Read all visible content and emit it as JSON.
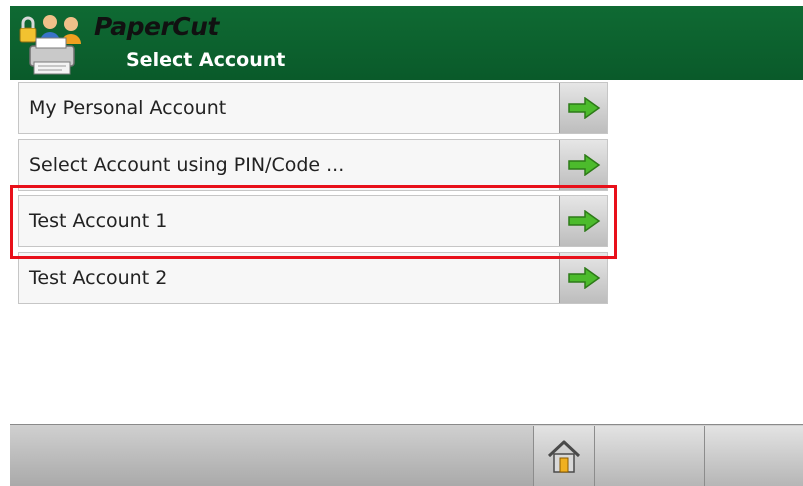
{
  "app": {
    "brand": "PaperCut",
    "screen_title": "Select Account"
  },
  "accounts": [
    {
      "label": "My Personal Account",
      "arrow_icon": "green-arrow-right-icon"
    },
    {
      "label": "Select Account using PIN/Code ...",
      "arrow_icon": "green-arrow-right-icon"
    },
    {
      "label": "Test Account 1",
      "arrow_icon": "green-arrow-right-icon",
      "highlighted": true
    },
    {
      "label": "Test Account 2",
      "arrow_icon": "green-arrow-right-icon"
    }
  ],
  "footer": {
    "buttons": [
      "home-icon",
      "",
      ""
    ]
  },
  "colors": {
    "header_green": "#0f6a33",
    "highlight_red": "#e8101a",
    "arrow_green": "#4cbb2c"
  }
}
